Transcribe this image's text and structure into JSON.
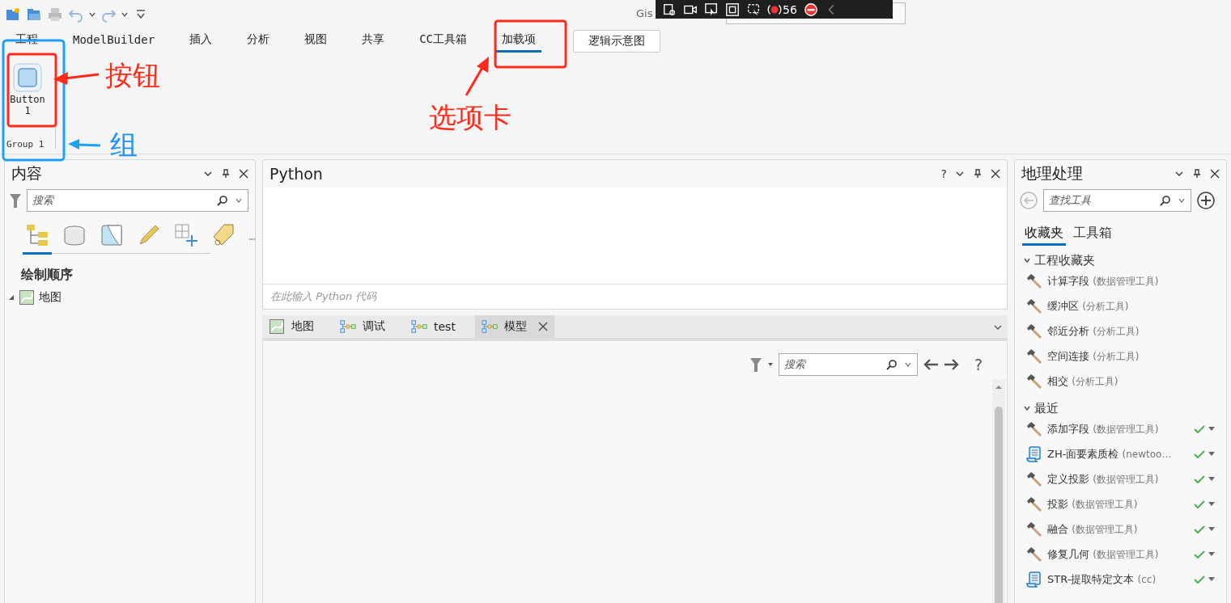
{
  "app": {
    "title": "Gis"
  },
  "overlay_toolbar": {
    "count": "56"
  },
  "menu_tabs": [
    {
      "label": "工程",
      "selected": false,
      "kind": "tab"
    },
    {
      "label": "ModelBuilder",
      "selected": false,
      "kind": "tab"
    },
    {
      "label": "插入",
      "selected": false,
      "kind": "tab"
    },
    {
      "label": "分析",
      "selected": false,
      "kind": "tab"
    },
    {
      "label": "视图",
      "selected": false,
      "kind": "tab"
    },
    {
      "label": "共享",
      "selected": false,
      "kind": "tab"
    },
    {
      "label": "CC工具箱",
      "selected": false,
      "kind": "tab"
    },
    {
      "label": "加载项",
      "selected": true,
      "kind": "tab"
    },
    {
      "label": "逻辑示意图",
      "selected": false,
      "kind": "contextual"
    }
  ],
  "ribbon": {
    "groups": [
      {
        "label": "Group 1",
        "buttons": [
          {
            "label": "Button 1"
          }
        ]
      }
    ]
  },
  "annotations": [
    {
      "text": "按钮",
      "color": "#ff2a1a"
    },
    {
      "text": "选项卡",
      "color": "#ff2a1a"
    },
    {
      "text": "组",
      "color": "#1e90ff"
    }
  ],
  "contents": {
    "title": "内容",
    "search": {
      "placeholder": "搜索"
    },
    "view_tabs": [
      {
        "selected": true
      },
      {
        "selected": false
      },
      {
        "selected": false
      },
      {
        "selected": false
      },
      {
        "selected": false
      },
      {
        "selected": false
      }
    ],
    "heading": "绘制顺序",
    "tree": [
      {
        "label": "地图",
        "expanded": true
      }
    ]
  },
  "python": {
    "title": "Python",
    "help": "?",
    "placeholder": "在此输入 Python 代码"
  },
  "doc_tabs": [
    {
      "label": "地图",
      "kind": "map",
      "selected": false
    },
    {
      "label": "调试",
      "kind": "model",
      "selected": false
    },
    {
      "label": "test",
      "kind": "model",
      "selected": false
    },
    {
      "label": "模型",
      "kind": "model",
      "selected": true
    }
  ],
  "model_view": {
    "search": {
      "placeholder": "搜索"
    },
    "help": "?"
  },
  "geoprocessing": {
    "title": "地理处理",
    "search": {
      "placeholder": "查找工具"
    },
    "tabs": [
      {
        "label": "收藏夹",
        "selected": true
      },
      {
        "label": "工具箱",
        "selected": false
      }
    ],
    "sections": [
      {
        "title": "工程收藏夹",
        "expanded": true,
        "items": [
          {
            "name": "计算字段",
            "source": "(数据管理工具)",
            "kind": "tool",
            "succeeded": false
          },
          {
            "name": "缓冲区",
            "source": "(分析工具)",
            "kind": "tool",
            "succeeded": false
          },
          {
            "name": "邻近分析",
            "source": "(分析工具)",
            "kind": "tool",
            "succeeded": false
          },
          {
            "name": "空间连接",
            "source": "(分析工具)",
            "kind": "tool",
            "succeeded": false
          },
          {
            "name": "相交",
            "source": "(分析工具)",
            "kind": "tool",
            "succeeded": false
          }
        ]
      },
      {
        "title": "最近",
        "expanded": true,
        "items": [
          {
            "name": "添加字段",
            "source": "(数据管理工具)",
            "kind": "tool",
            "succeeded": true
          },
          {
            "name": "ZH-面要素质检",
            "source": "(newtoo…",
            "kind": "script",
            "succeeded": true
          },
          {
            "name": "定义投影",
            "source": "(数据管理工具)",
            "kind": "tool",
            "succeeded": true
          },
          {
            "name": "投影",
            "source": "(数据管理工具)",
            "kind": "tool",
            "succeeded": true
          },
          {
            "name": "融合",
            "source": "(数据管理工具)",
            "kind": "tool",
            "succeeded": true
          },
          {
            "name": "修复几何",
            "source": "(数据管理工具)",
            "kind": "tool",
            "succeeded": true
          },
          {
            "name": "STR-提取特定文本",
            "source": "(cc)",
            "kind": "script",
            "succeeded": true
          }
        ]
      }
    ]
  }
}
